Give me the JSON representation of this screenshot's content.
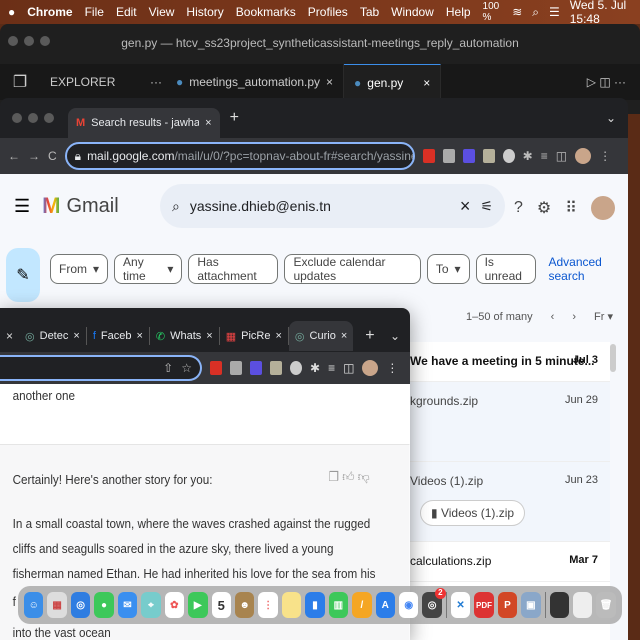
{
  "menubar": {
    "app": "Chrome",
    "items": [
      "File",
      "Edit",
      "View",
      "History",
      "Bookmarks",
      "Profiles",
      "Tab",
      "Window",
      "Help"
    ],
    "battery": "100 %",
    "datetime": "Wed 5. Jul 15:48"
  },
  "vscode": {
    "title": "gen.py — htcv_ss23project_syntheticassistant-meetings_reply_automation",
    "explorer": "EXPLORER",
    "tabs": [
      {
        "label": "meetings_automation.py"
      },
      {
        "label": "gen.py"
      }
    ]
  },
  "chrome_back": {
    "tab": "Search results - jawharsd@gm",
    "url_host": "mail.google.com",
    "url_path": "/mail/u/0/?pc=topnav-about-fr#search/yassine.dhie..."
  },
  "gmail": {
    "logo": "Gmail",
    "search_value": "yassine.dhieb@enis.tn",
    "filters": [
      "From",
      "Any time",
      "Has attachment",
      "Exclude calendar updates",
      "To",
      "Is unread"
    ],
    "advanced": "Advanced search",
    "pager": "1–50 of many",
    "lang": "Fr",
    "rows": [
      {
        "subject": "We have a meeting in 5 minute...",
        "date": "Jul 3",
        "unread": true
      },
      {
        "subject": "kgrounds.zip",
        "date": "Jun 29",
        "unread": false
      },
      {
        "subject": "Videos (1).zip",
        "date": "Jun 23",
        "unread": false,
        "attachment": "Videos (1).zip"
      },
      {
        "subject": "calculations.zip",
        "date": "Mar 7",
        "unread": true
      }
    ]
  },
  "chrome_front": {
    "tabs": [
      "Detec",
      "Faceb",
      "Whats",
      "PicRe",
      "Curio"
    ]
  },
  "chat": {
    "user_msg": "another one",
    "reply_intro": "Certainly! Here's another story for you:",
    "lines": [
      "In a small coastal town, where the waves crashed against the rugged",
      "cliffs and seagulls soared in the azure sky, there lived a young",
      "fisherman named Ethan. He had inherited his love for the sea from his",
      "f",
      "into the vast ocean"
    ]
  },
  "dock": {
    "calendar_day": "5",
    "badge": "2",
    "pdf": "PDF"
  }
}
